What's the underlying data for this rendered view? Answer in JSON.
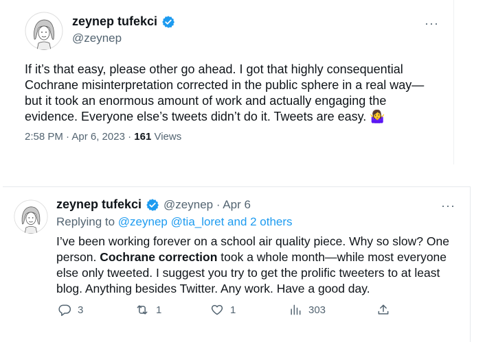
{
  "tweet1": {
    "author_name": "zeynep tufekci",
    "handle": "@zeynep",
    "body": "If it’s that easy, please other go ahead. I got that highly consequential Cochrane misinterpretation corrected in the public sphere in a real way—but it took an enormous amount of work and actually engaging the evidence. Everyone else’s tweets didn’t do it. Tweets are easy. ",
    "emoji": "🤷‍♀️",
    "timestamp": "2:58 PM · Apr 6, 2023 · ",
    "views_count": "161",
    "views_label": " Views",
    "more": "···"
  },
  "tweet2": {
    "author_name": "zeynep tufekci",
    "handle_date": "@zeynep · Apr 6",
    "more": "···",
    "replying_prefix": "Replying to ",
    "replying_targets": "@zeynep @tia_loret and 2 others",
    "body_part1": "I’ve been working forever on a school air quality piece. Why so slow? One person. ",
    "body_bold": "Cochrane correction",
    "body_part2": " took a whole month—while most everyone else only tweeted. I suggest you try to get the prolific tweeters to at least blog. Anything besides Twitter. Any work. Have a good day.",
    "actions": {
      "replies": "3",
      "retweets": "1",
      "likes": "1",
      "views": "303"
    }
  },
  "colors": {
    "text": "#0f1419",
    "secondary": "#536471",
    "link": "#1d9bf0",
    "verified": "#1d9bf0"
  }
}
